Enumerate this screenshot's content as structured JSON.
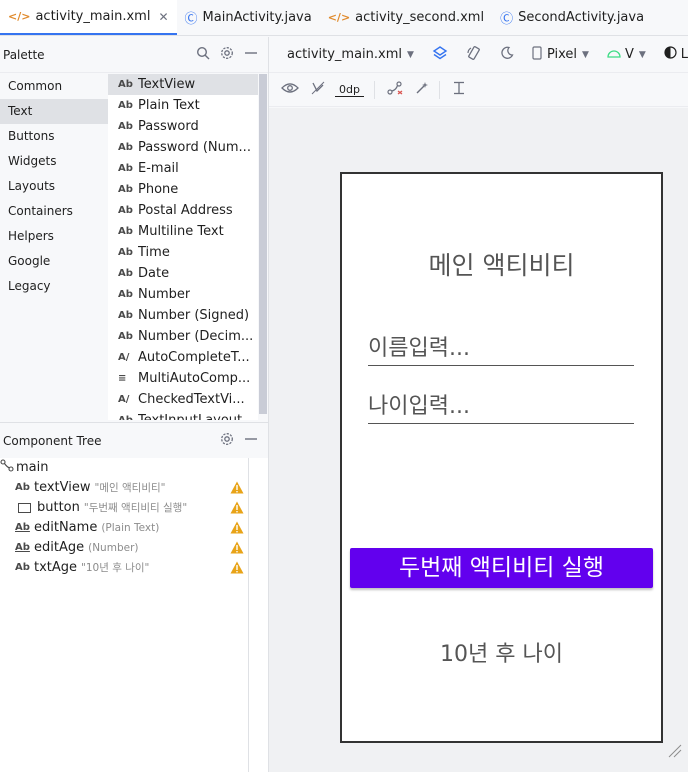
{
  "tabs": [
    {
      "label": "activity_main.xml",
      "type": "xml",
      "active": true,
      "closable": true
    },
    {
      "label": "MainActivity.java",
      "type": "java",
      "active": false
    },
    {
      "label": "activity_second.xml",
      "type": "xml",
      "active": false
    },
    {
      "label": "SecondActivity.java",
      "type": "java",
      "active": false
    }
  ],
  "palette": {
    "title": "Palette",
    "categories": [
      "Common",
      "Text",
      "Buttons",
      "Widgets",
      "Layouts",
      "Containers",
      "Helpers",
      "Google",
      "Legacy"
    ],
    "active_category": "Text",
    "widgets": [
      {
        "icon": "Ab",
        "label": "TextView"
      },
      {
        "icon": "Ab",
        "label": "Plain Text"
      },
      {
        "icon": "Ab",
        "label": "Password"
      },
      {
        "icon": "Ab",
        "label": "Password (Num..."
      },
      {
        "icon": "Ab",
        "label": "E-mail"
      },
      {
        "icon": "Ab",
        "label": "Phone"
      },
      {
        "icon": "Ab",
        "label": "Postal Address"
      },
      {
        "icon": "Ab",
        "label": "Multiline Text"
      },
      {
        "icon": "Ab",
        "label": "Time"
      },
      {
        "icon": "Ab",
        "label": "Date"
      },
      {
        "icon": "Ab",
        "label": "Number"
      },
      {
        "icon": "Ab",
        "label": "Number (Signed)"
      },
      {
        "icon": "Ab",
        "label": "Number (Decim..."
      },
      {
        "icon": "A/",
        "label": "AutoCompleteT..."
      },
      {
        "icon": "≡",
        "label": "MultiAutoComp..."
      },
      {
        "icon": "A/",
        "label": "CheckedTextVi..."
      },
      {
        "icon": "Ab",
        "label": "TextInputLayout"
      }
    ]
  },
  "component_tree": {
    "title": "Component Tree",
    "root": "main",
    "items": [
      {
        "icon": "Ab",
        "name": "textView",
        "hint": "\"메인 액티비티\"",
        "warning": true
      },
      {
        "icon": "button",
        "name": "button",
        "hint": "\"두번째 액티비티 실행\"",
        "warning": true
      },
      {
        "icon": "Ab",
        "name": "editName",
        "hint": "(Plain Text)",
        "warning": true
      },
      {
        "icon": "Ab",
        "name": "editAge",
        "hint": "(Number)",
        "warning": true
      },
      {
        "icon": "Ab",
        "name": "txtAge",
        "hint": "\"10년 후 나이\"",
        "warning": true
      }
    ]
  },
  "design_toolbar": {
    "file": "activity_main.xml",
    "device": "Pixel",
    "api": "V",
    "theme": "Li",
    "margin": "0dp"
  },
  "preview": {
    "title": "메인 액티비티",
    "name_hint": "이름입력...",
    "age_hint": "나이입력...",
    "button_label": "두번째 액티비티 실행",
    "footer_text": "10년 후 나이",
    "button_color": "#6200ee"
  },
  "colors": {
    "accent": "#3574f0",
    "warning": "#e8a317",
    "xml_icon": "#e08a2c"
  }
}
